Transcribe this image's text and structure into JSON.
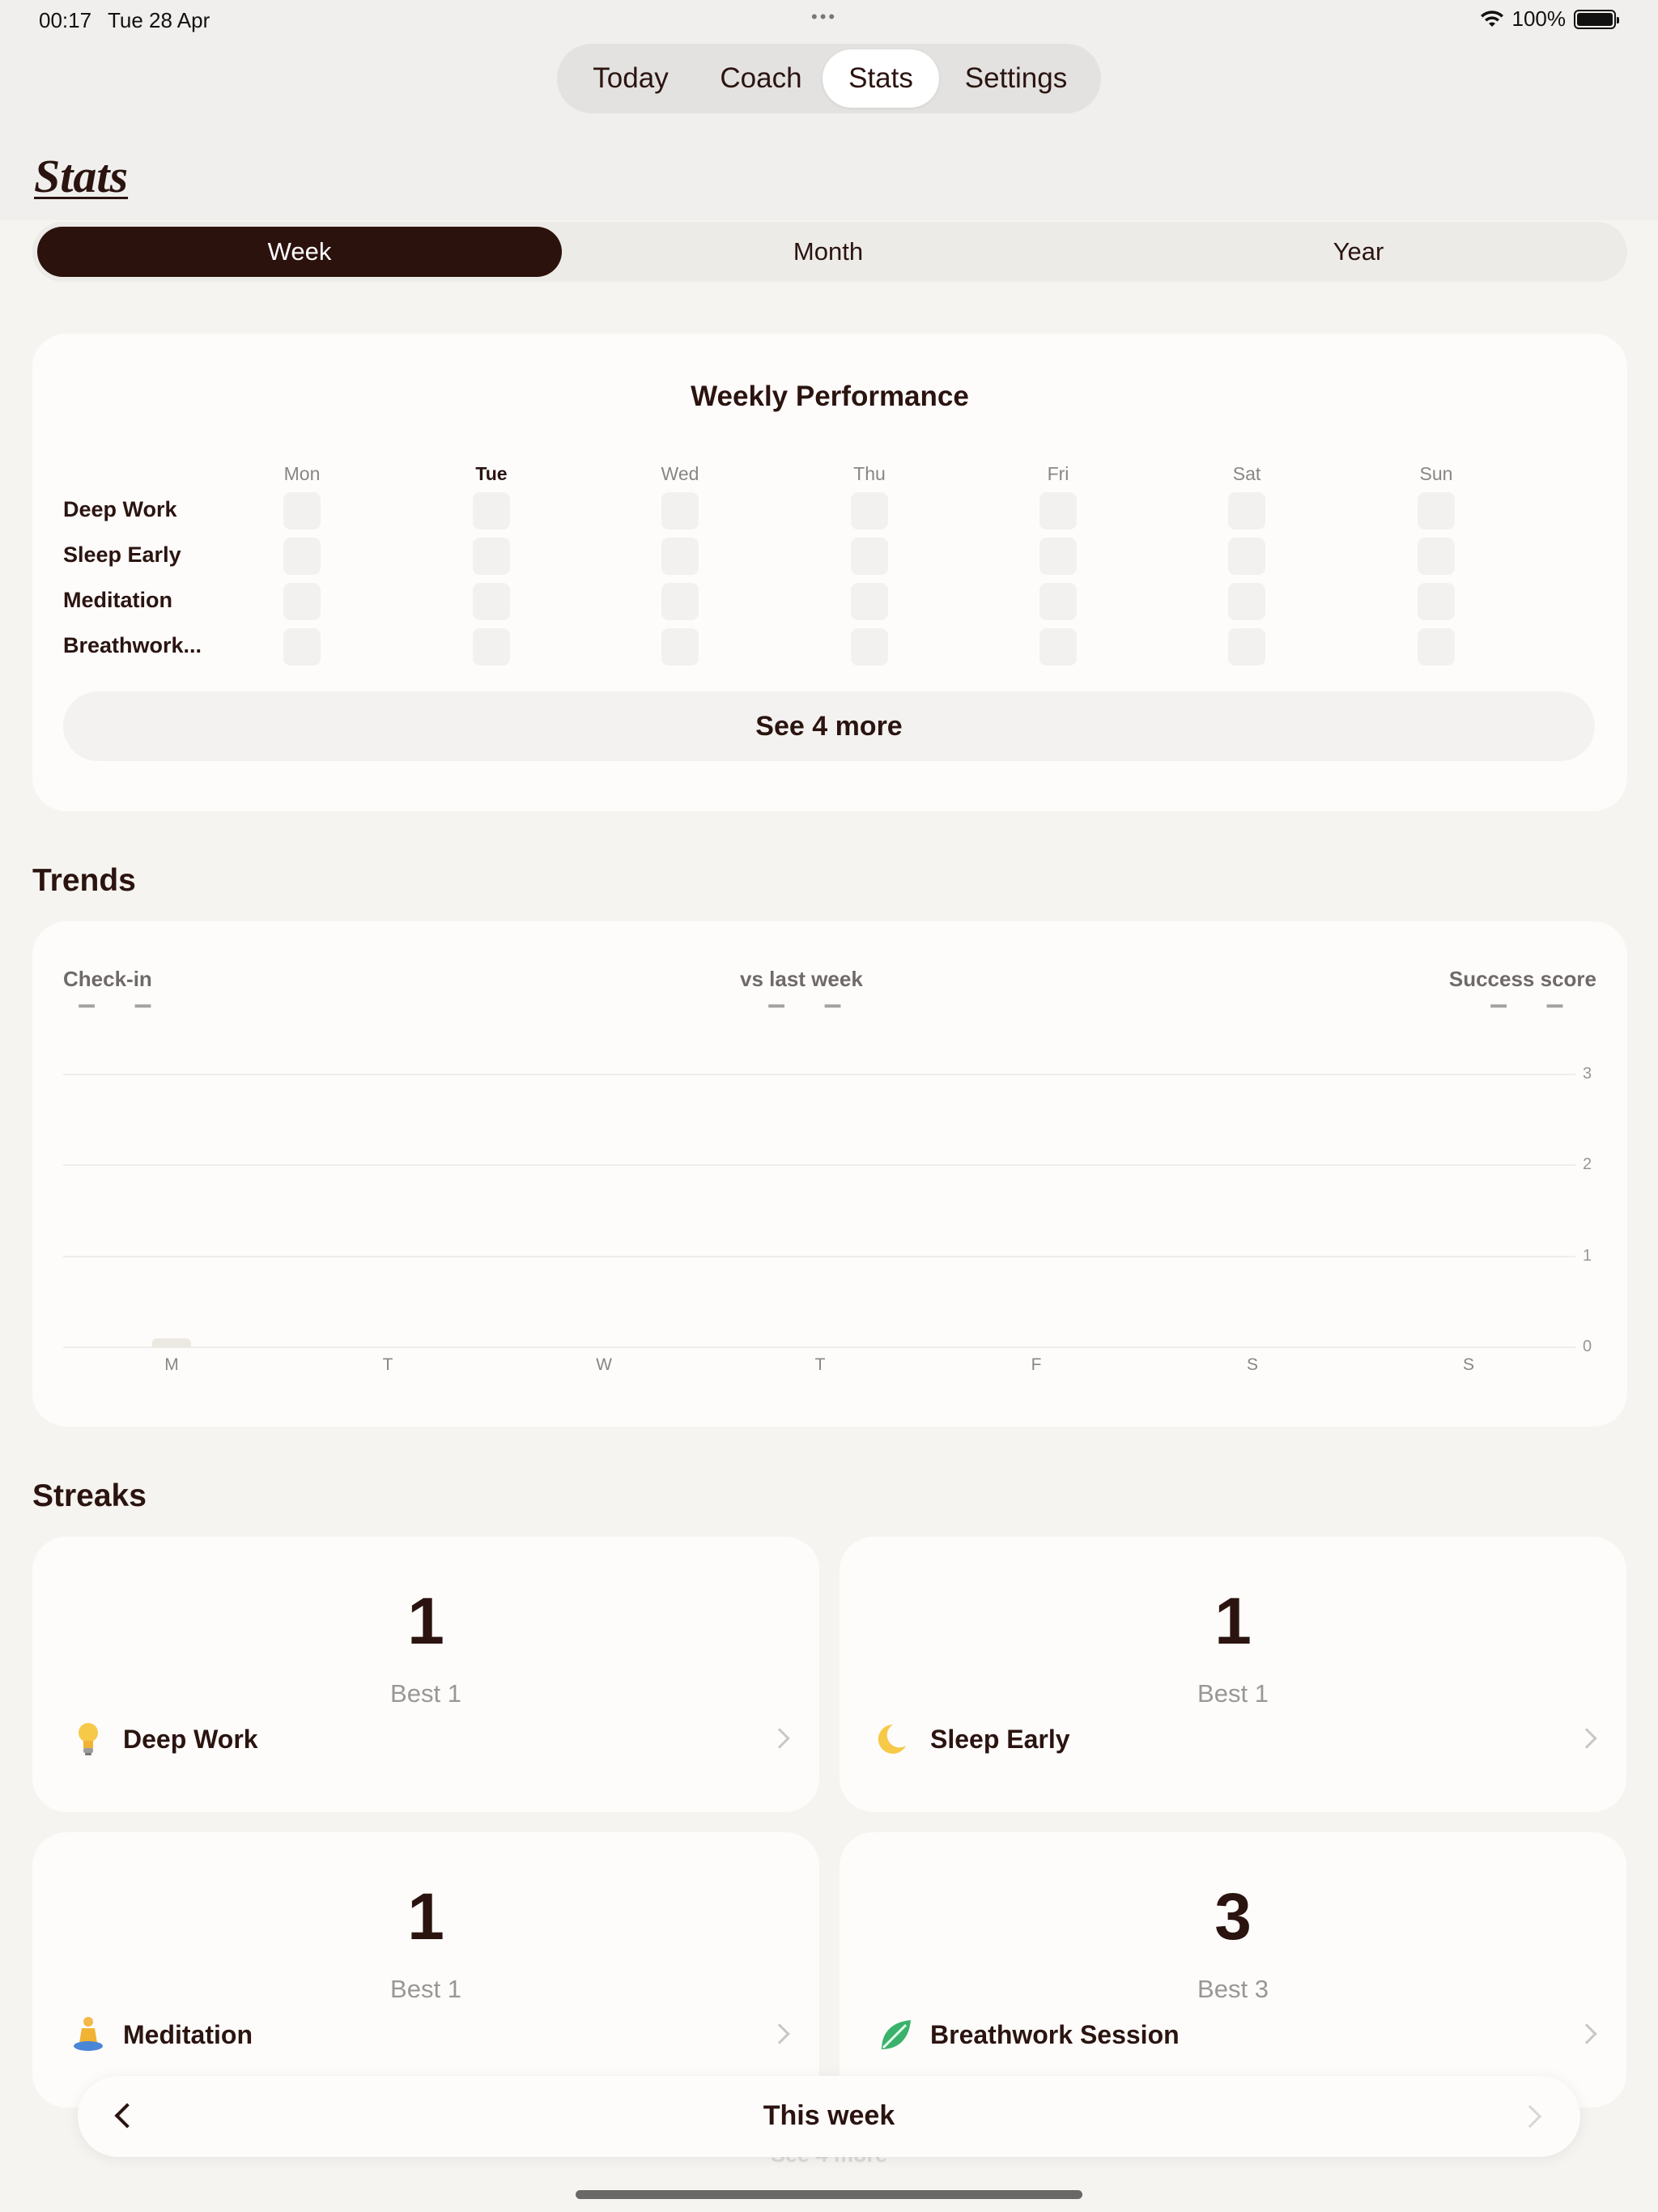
{
  "status": {
    "time": "00:17",
    "date": "Tue 28 Apr",
    "battery": "100%",
    "dots": "•••"
  },
  "nav": {
    "tabs": [
      "Today",
      "Coach",
      "Stats",
      "Settings"
    ],
    "active": "Stats"
  },
  "page": {
    "title": "Stats"
  },
  "period": {
    "options": [
      "Week",
      "Month",
      "Year"
    ],
    "selected": "Week"
  },
  "performance": {
    "title": "Weekly Performance",
    "days": [
      "Mon",
      "Tue",
      "Wed",
      "Thu",
      "Fri",
      "Sat",
      "Sun"
    ],
    "today": "Tue",
    "habits": [
      "Deep Work",
      "Sleep Early",
      "Meditation",
      "Breathwork..."
    ],
    "see_more": "See 4 more"
  },
  "trends": {
    "title": "Trends",
    "stats": [
      {
        "label": "Check-in",
        "value": "– –"
      },
      {
        "label": "vs last week",
        "value": "– –"
      },
      {
        "label": "Success score",
        "value": "– –"
      }
    ],
    "chart_data": {
      "type": "bar",
      "categories": [
        "M",
        "T",
        "W",
        "T",
        "F",
        "S",
        "S"
      ],
      "values": [
        0.1,
        0,
        0,
        0,
        0,
        0,
        0
      ],
      "ylim": [
        0,
        3
      ],
      "yticks": [
        "3",
        "2",
        "1",
        "0"
      ],
      "grid": true,
      "bar_color": "#ece9e3"
    }
  },
  "streaks": {
    "title": "Streaks",
    "items": [
      {
        "name": "Deep Work",
        "current": "1",
        "best": "Best 1",
        "icon": "lightbulb-icon"
      },
      {
        "name": "Sleep Early",
        "current": "1",
        "best": "Best 1",
        "icon": "moon-icon"
      },
      {
        "name": "Meditation",
        "current": "1",
        "best": "Best 1",
        "icon": "meditation-icon"
      },
      {
        "name": "Breathwork Session",
        "current": "3",
        "best": "Best 3",
        "icon": "leaf-icon"
      }
    ]
  },
  "footer": {
    "label": "This week",
    "ghost": "See 4 more"
  },
  "colors": {
    "accent": "#2c120d",
    "background": "#f6f4f0",
    "card": "#fdfcfb"
  }
}
